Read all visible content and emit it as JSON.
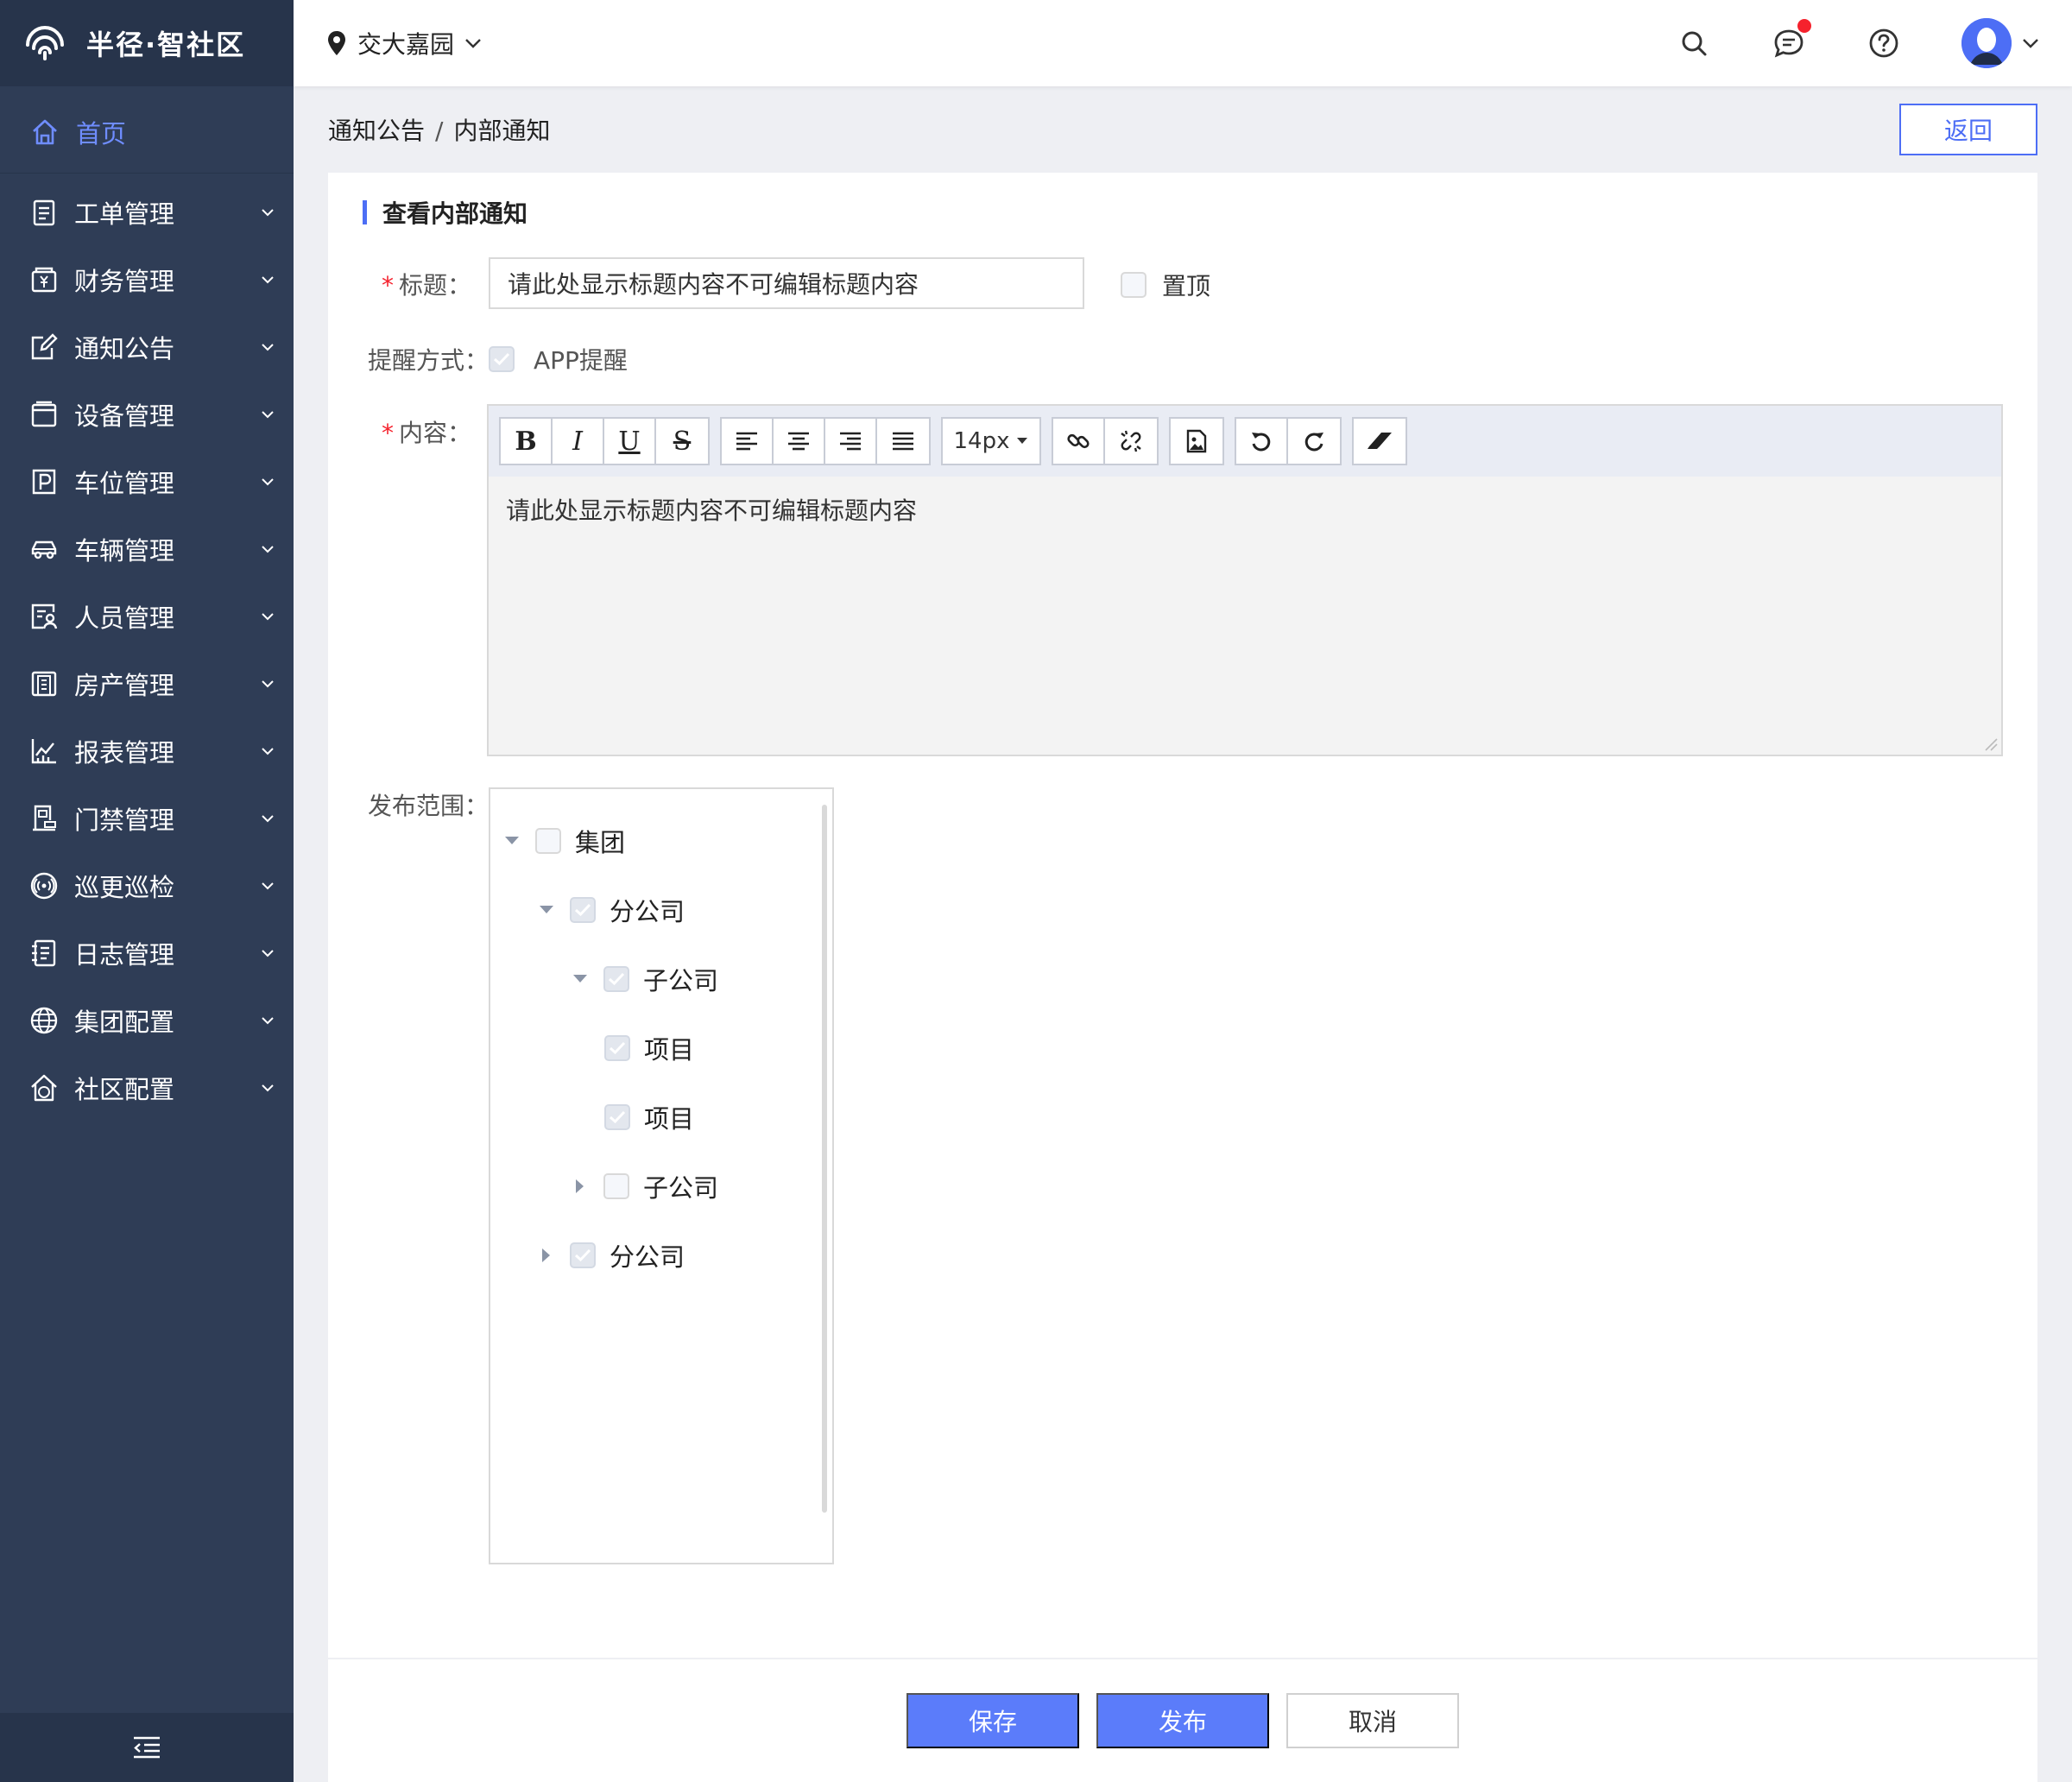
{
  "app": {
    "name": "半径·智社区"
  },
  "sidebar": {
    "home": "首页",
    "items": [
      {
        "label": "工单管理",
        "icon": "clipboard-icon"
      },
      {
        "label": "财务管理",
        "icon": "finance-icon"
      },
      {
        "label": "通知公告",
        "icon": "edit-note-icon"
      },
      {
        "label": "设备管理",
        "icon": "device-icon"
      },
      {
        "label": "车位管理",
        "icon": "parking-icon"
      },
      {
        "label": "车辆管理",
        "icon": "car-icon"
      },
      {
        "label": "人员管理",
        "icon": "person-card-icon"
      },
      {
        "label": "房产管理",
        "icon": "building-icon"
      },
      {
        "label": "报表管理",
        "icon": "chart-icon"
      },
      {
        "label": "门禁管理",
        "icon": "door-icon"
      },
      {
        "label": "巡更巡检",
        "icon": "patrol-icon"
      },
      {
        "label": "日志管理",
        "icon": "log-icon"
      },
      {
        "label": "集团配置",
        "icon": "globe-icon"
      },
      {
        "label": "社区配置",
        "icon": "community-icon"
      }
    ]
  },
  "header": {
    "location": "交大嘉园",
    "has_unread_messages": true
  },
  "breadcrumb": {
    "parent": "通知公告",
    "separator": "/",
    "current": "内部通知"
  },
  "back_label": "返回",
  "form": {
    "section_title": "查看内部通知",
    "title_label": "标题：",
    "title_value": "请此处显示标题内容不可编辑标题内容",
    "pin_label": "置顶",
    "pin_checked": false,
    "remind_label": "提醒方式：",
    "remind_option": "APP提醒",
    "remind_checked": true,
    "content_label": "内容：",
    "font_size": "14px",
    "content_value": "请此处显示标题内容不可编辑标题内容",
    "scope_label": "发布范围："
  },
  "tree": [
    {
      "label": "集团",
      "checked": false,
      "expanded": true
    },
    {
      "label": "分公司",
      "checked": true,
      "expanded": true
    },
    {
      "label": "子公司",
      "checked": true,
      "expanded": true
    },
    {
      "label": "项目",
      "checked": true
    },
    {
      "label": "项目",
      "checked": true
    },
    {
      "label": "子公司",
      "checked": false,
      "expanded": false
    },
    {
      "label": "分公司",
      "checked": true,
      "expanded": false
    }
  ],
  "buttons": {
    "save": "保存",
    "publish": "发布",
    "cancel": "取消"
  },
  "colors": {
    "accent": "#4d6ef5",
    "sidebar": "#2f3d56",
    "danger": "#f5222d"
  }
}
